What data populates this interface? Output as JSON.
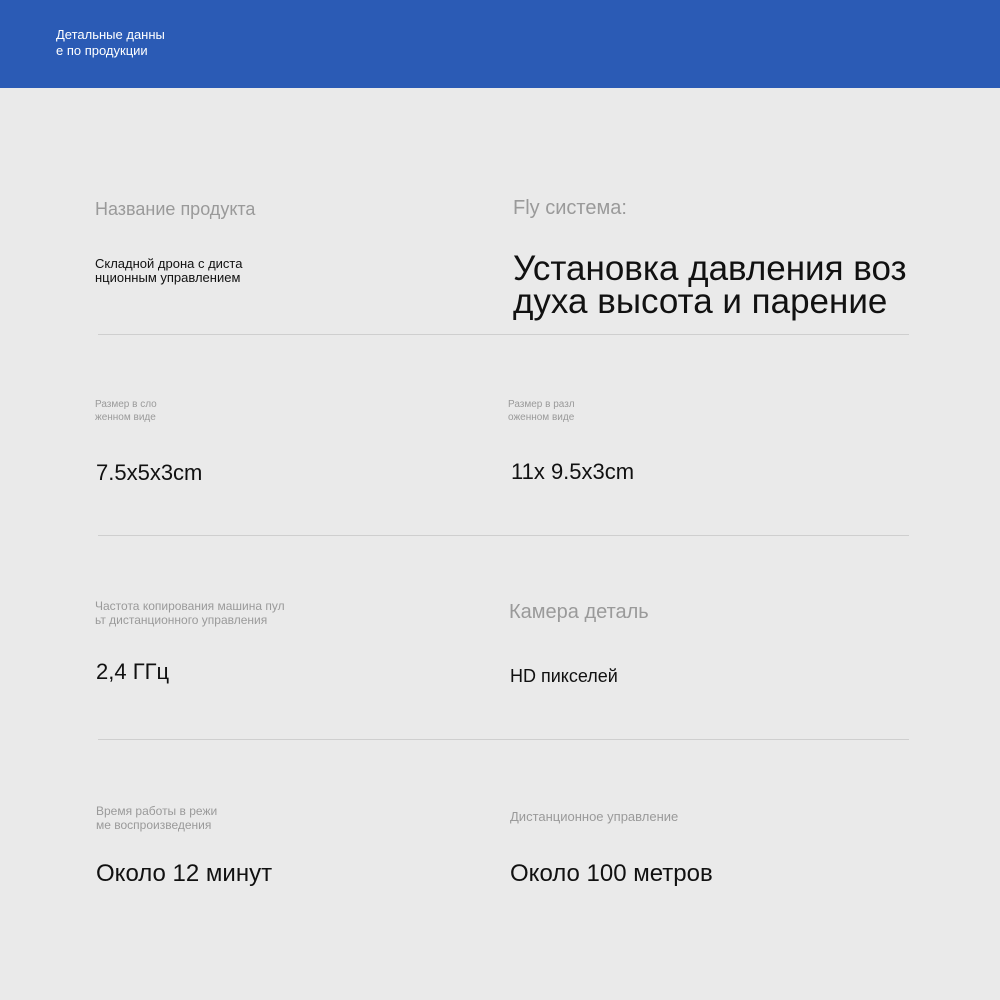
{
  "header": {
    "title": "Детальные данны\nе по продукции"
  },
  "rows": [
    {
      "left": {
        "label": "Название продукта",
        "value": "Складной дрона с диста\nнционным управлением"
      },
      "right": {
        "label": "Fly система:",
        "value": "Установка давления воз\nдуха высота и парение"
      }
    },
    {
      "left": {
        "label": "Размер в сло\nженном виде",
        "value": "7.5x5x3cm"
      },
      "right": {
        "label": "Размер в разл\nоженном виде",
        "value": "11x 9.5x3cm"
      }
    },
    {
      "left": {
        "label": "Частота копирования машина пул\nьт дистанционного управления",
        "value": "2,4 ГГц"
      },
      "right": {
        "label": "Камера деталь",
        "value": "HD пикселей"
      }
    },
    {
      "left": {
        "label": "Время работы в режи\nме воспроизведения",
        "value": "Около 12 минут"
      },
      "right": {
        "label": "Дистанционное управление",
        "value": "Около 100 метров"
      }
    }
  ],
  "colors": {
    "header_bg": "#2b5bb5",
    "page_bg": "#eaeaea",
    "label": "#9a9a9a",
    "value": "#111111",
    "divider": "#cfcfcf"
  }
}
